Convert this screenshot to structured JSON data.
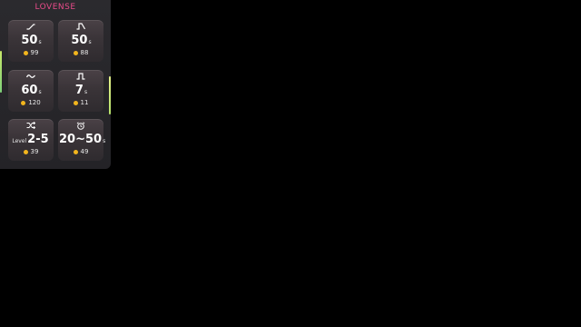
{
  "brand": "LOVENSE",
  "colors": {
    "brand": "#e94b8a",
    "coin": "#f2b51d",
    "accent_bar": "#c7e86a",
    "background": "#000000",
    "panel": "#2b2a2e"
  },
  "tiles": [
    {
      "icon": "ramp-up-icon",
      "prefix": "",
      "value": "50",
      "unit": "s",
      "price": "99"
    },
    {
      "icon": "pulse-up-icon",
      "prefix": "",
      "value": "50",
      "unit": "s",
      "price": "88"
    },
    {
      "icon": "wave-icon",
      "prefix": "",
      "value": "60",
      "unit": "s",
      "price": "120"
    },
    {
      "icon": "square-pulse-icon",
      "prefix": "",
      "value": "7",
      "unit": "s",
      "price": "11"
    },
    {
      "icon": "shuffle-icon",
      "prefix": "Level",
      "value": "2-5",
      "unit": "",
      "price": "39"
    },
    {
      "icon": "alarm-clock-icon",
      "prefix": "",
      "value": "20~50",
      "unit": "s",
      "price": "49"
    }
  ]
}
